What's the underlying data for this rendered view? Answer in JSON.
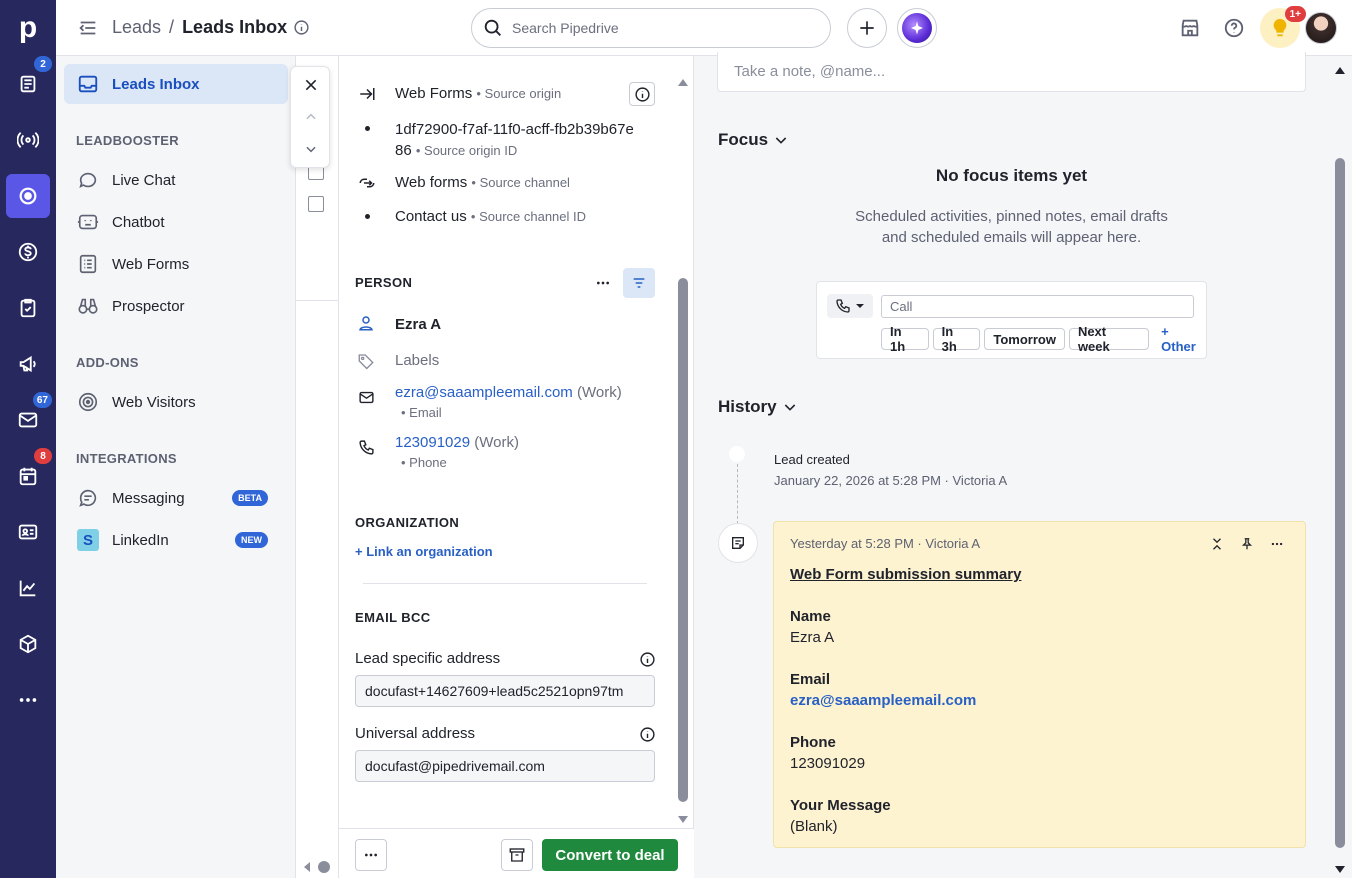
{
  "app": {
    "logo": "p"
  },
  "rail": {
    "items": [
      {
        "name": "deals-icon",
        "badge": "2",
        "badge_color": "#3166d8"
      },
      {
        "name": "campaigns-icon"
      },
      {
        "name": "leads-icon"
      },
      {
        "name": "money-icon"
      },
      {
        "name": "activities-icon"
      },
      {
        "name": "megaphone-icon"
      },
      {
        "name": "mail-icon",
        "badge": "67",
        "badge_color": "#3166d8"
      },
      {
        "name": "calendar-icon",
        "badge": "8",
        "badge_color": "#e03e3e"
      },
      {
        "name": "contacts-icon"
      },
      {
        "name": "insights-icon"
      },
      {
        "name": "products-icon"
      },
      {
        "name": "more-icon"
      }
    ]
  },
  "topbar": {
    "breadcrumb_root": "Leads",
    "breadcrumb_sep": "/",
    "breadcrumb_current": "Leads Inbox",
    "search_placeholder": "Search Pipedrive",
    "notif_badge": "1+"
  },
  "subnav": {
    "active": "Leads Inbox",
    "section_leadbooster": "LEADBOOSTER",
    "live_chat": "Live Chat",
    "chatbot": "Chatbot",
    "web_forms": "Web Forms",
    "prospector": "Prospector",
    "section_addons": "ADD-ONS",
    "web_visitors": "Web Visitors",
    "section_integrations": "INTEGRATIONS",
    "messaging": "Messaging",
    "messaging_pill": "BETA",
    "linkedin": "LinkedIn",
    "linkedin_pill": "NEW"
  },
  "detail": {
    "source_origin_value": "Web Forms",
    "source_origin_label": "Source origin",
    "source_origin_id_value": "1df72900-f7af-11f0-acff-fb2b39b67e86",
    "source_origin_id_label": "Source origin ID",
    "source_channel_value": "Web forms",
    "source_channel_label": "Source channel",
    "source_channel_id_value": "Contact us",
    "source_channel_id_label": "Source channel ID",
    "person_title": "PERSON",
    "person_name": "Ezra A",
    "labels_placeholder": "Labels",
    "email_value": "ezra@saaampleemail.com",
    "email_type": "(Work)",
    "email_label": "Email",
    "phone_value": "123091029",
    "phone_type": "(Work)",
    "phone_label": "Phone",
    "org_title": "ORGANIZATION",
    "org_link": "+ Link an organization",
    "bcc_title": "EMAIL BCC",
    "lead_addr_label": "Lead specific address",
    "lead_addr_value": "docufast+14627609+lead5c2521opn97tm",
    "universal_addr_label": "Universal address",
    "universal_addr_value": "docufast@pipedrivemail.com",
    "convert_label": "Convert to deal"
  },
  "right": {
    "note_placeholder": "Take a note, @name...",
    "focus_title": "Focus",
    "focus_empty_title": "No focus items yet",
    "focus_empty_line1": "Scheduled activities, pinned notes, email drafts",
    "focus_empty_line2": "and scheduled emails will appear here.",
    "call_placeholder": "Call",
    "chips": [
      "In 1h",
      "In 3h",
      "Tomorrow",
      "Next week"
    ],
    "other_link": "+ Other",
    "history_title": "History",
    "lead_created": "Lead created",
    "lead_created_meta": "January 22, 2026 at 5:28 PM · Victoria A",
    "note_meta": "Yesterday at 5:28 PM · Victoria A",
    "note_heading": "Web Form submission summary",
    "name_label": "Name",
    "name_value": "Ezra A",
    "email_label": "Email",
    "email_value": "ezra@saaampleemail.com",
    "phone_label": "Phone",
    "phone_value": "123091029",
    "message_label": "Your Message",
    "message_value": "(Blank)"
  },
  "colors": {
    "rail": "#26285e",
    "accent": "#5a56e6",
    "link": "#2860c6",
    "convert": "#1f8a3d",
    "note_bg": "#fdf3d0"
  }
}
